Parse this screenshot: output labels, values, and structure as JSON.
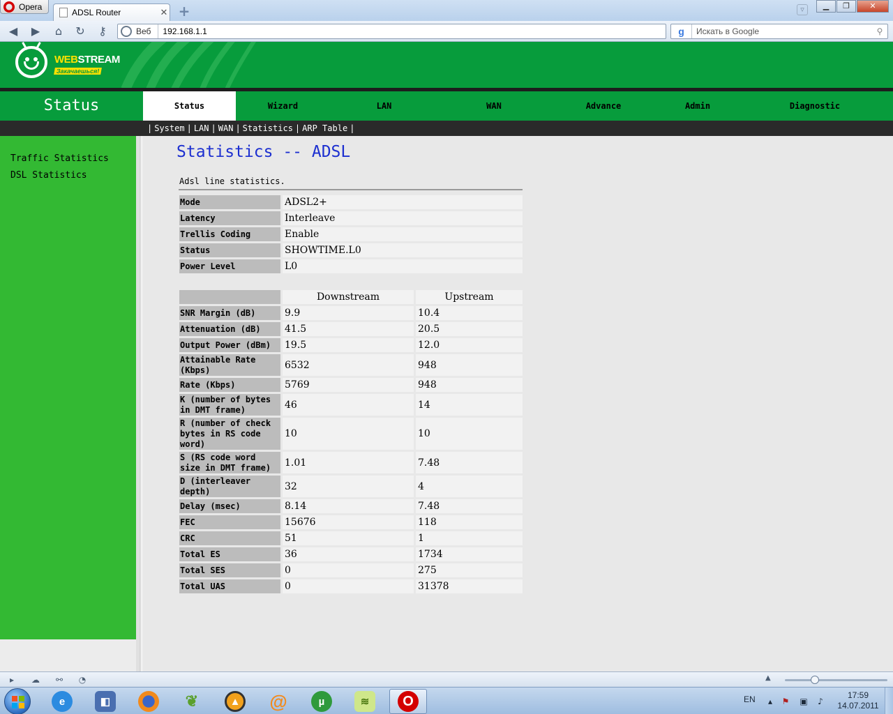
{
  "browser": {
    "menu_label": "Opera",
    "tab_title": "ADSL Router",
    "tab_close": "✕",
    "new_tab": "+",
    "address_zone": "Веб",
    "address_url": "192.168.1.1",
    "search_placeholder": "Искать в Google",
    "search_engine_glyph": "g"
  },
  "router": {
    "brand_web": "WEB",
    "brand_stream": "STREAM",
    "tagline": "Закачаешься!",
    "section_title": "Status",
    "menu": [
      {
        "label": "Status",
        "active": true
      },
      {
        "label": "Wizard"
      },
      {
        "label": "LAN"
      },
      {
        "label": "WAN"
      },
      {
        "label": "Advance"
      },
      {
        "label": "Admin"
      },
      {
        "label": "Diagnostic"
      }
    ],
    "submenu": [
      "System",
      "LAN",
      "WAN",
      "Statistics",
      "ARP Table"
    ],
    "sidebar": [
      "Traffic Statistics",
      "DSL Statistics"
    ],
    "page_title": "Statistics -- ADSL",
    "intro": "Adsl line statistics."
  },
  "line_info": [
    {
      "label": "Mode",
      "value": "ADSL2+"
    },
    {
      "label": "Latency",
      "value": "Interleave"
    },
    {
      "label": "Trellis Coding",
      "value": "Enable"
    },
    {
      "label": "Status",
      "value": "SHOWTIME.L0"
    },
    {
      "label": "Power Level",
      "value": "L0"
    }
  ],
  "stats_table": {
    "columns": [
      "Downstream",
      "Upstream"
    ],
    "rows": [
      {
        "label": "SNR Margin (dB)",
        "down": "9.9",
        "up": "10.4"
      },
      {
        "label": "Attenuation (dB)",
        "down": "41.5",
        "up": "20.5"
      },
      {
        "label": "Output Power (dBm)",
        "down": "19.5",
        "up": "12.0"
      },
      {
        "label": "Attainable Rate (Kbps)",
        "down": "6532",
        "up": "948"
      },
      {
        "label": "Rate (Kbps)",
        "down": "5769",
        "up": "948"
      },
      {
        "label": "K (number of bytes in DMT frame)",
        "down": "46",
        "up": "14"
      },
      {
        "label": "R (number of check bytes in RS code word)",
        "down": "10",
        "up": "10"
      },
      {
        "label": "S (RS code word size in DMT frame)",
        "down": "1.01",
        "up": "7.48"
      },
      {
        "label": "D (interleaver depth)",
        "down": "32",
        "up": "4"
      },
      {
        "label": "Delay (msec)",
        "down": "8.14",
        "up": "7.48"
      },
      {
        "label": "FEC",
        "down": "15676",
        "up": "118"
      },
      {
        "label": "CRC",
        "down": "51",
        "up": "1"
      },
      {
        "label": "Total ES",
        "down": "36",
        "up": "1734"
      },
      {
        "label": "Total SES",
        "down": "0",
        "up": "275"
      },
      {
        "label": "Total UAS",
        "down": "0",
        "up": "31378"
      }
    ]
  },
  "taskbar": {
    "language": "EN",
    "time": "17:59",
    "date": "14.07.2011",
    "opera_glyph": "O",
    "utorrent_glyph": "µ"
  },
  "colors": {
    "brand_green": "#079c3c",
    "sidebar_green": "#33b933",
    "title_blue": "#1c2fd0",
    "label_gray": "#bcbcbc"
  }
}
